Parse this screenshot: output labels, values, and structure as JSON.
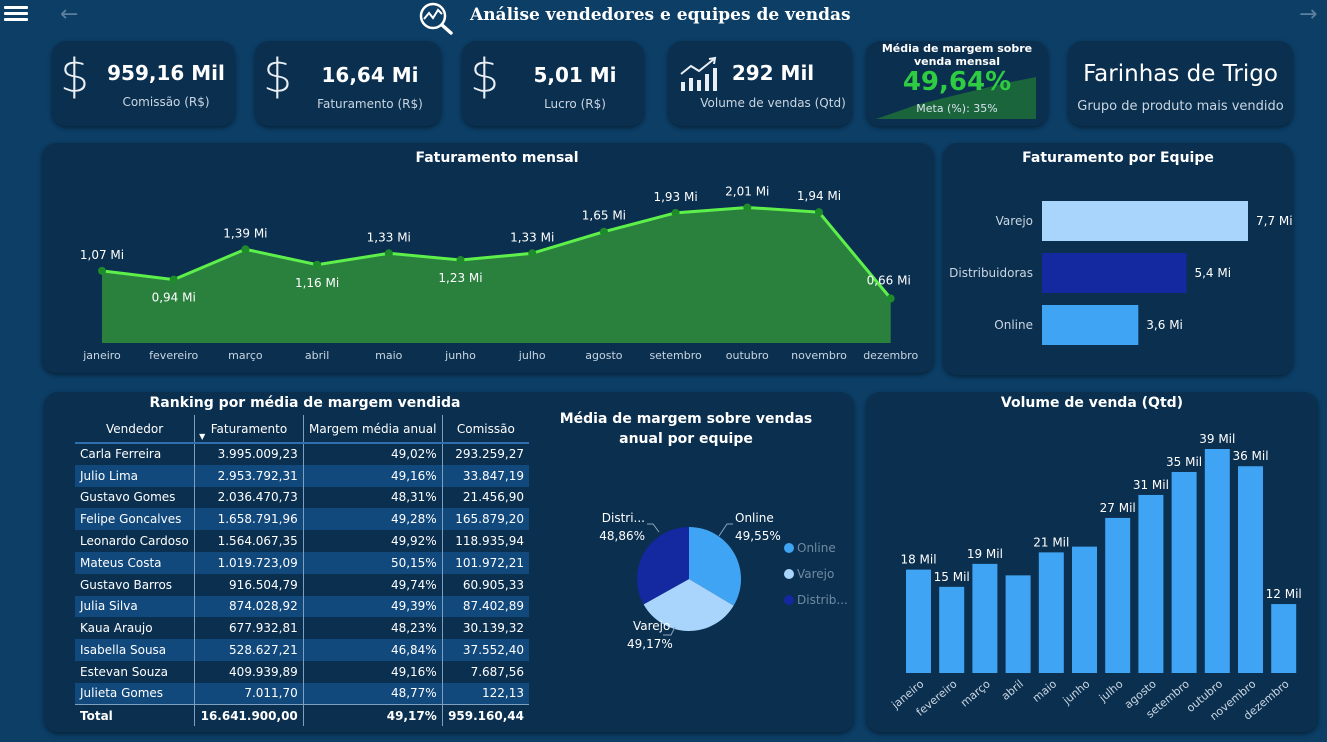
{
  "header": {
    "title": "Análise vendedores e equipes de vendas"
  },
  "kpis": {
    "comissao": {
      "value": "959,16 Mil",
      "label": "Comissão (R$)"
    },
    "faturamento": {
      "value": "16,64 Mi",
      "label": "Faturamento (R$)"
    },
    "lucro": {
      "value": "5,01 Mi",
      "label": "Lucro (R$)"
    },
    "volume": {
      "value": "292 Mil",
      "label": "Volume de vendas (Qtd)"
    },
    "margem": {
      "title": "Média de margem sobre venda mensal",
      "value": "49,64%",
      "meta": "Meta (%): 35%"
    },
    "grupo": {
      "value": "Farinhas de Trigo",
      "label": "Grupo de produto mais vendido"
    }
  },
  "colors": {
    "background": "#0c3e66",
    "card": "#0b2f4f",
    "line": "#5ef04a",
    "area": "#2e8b3c",
    "barLight": "#a9d4fb",
    "barNavy": "#1428a0",
    "barBlue": "#40a4f4",
    "marginGreen": "#2ecc40"
  },
  "chart_data": [
    {
      "id": "monthly",
      "type": "area",
      "title": "Faturamento mensal",
      "categories": [
        "janeiro",
        "fevereiro",
        "março",
        "abril",
        "maio",
        "junho",
        "julho",
        "agosto",
        "setembro",
        "outubro",
        "novembro",
        "dezembro"
      ],
      "values": [
        1.07,
        0.94,
        1.39,
        1.16,
        1.33,
        1.23,
        1.33,
        1.65,
        1.93,
        2.01,
        1.94,
        0.66
      ],
      "labels": [
        "1,07 Mi",
        "0,94 Mi",
        "1,39 Mi",
        "1,16 Mi",
        "1,33 Mi",
        "1,23 Mi",
        "1,33 Mi",
        "1,65 Mi",
        "1,93 Mi",
        "2,01 Mi",
        "1,94 Mi",
        "0,66 Mi"
      ]
    },
    {
      "id": "team",
      "type": "bar",
      "title": "Faturamento por Equipe",
      "categories": [
        "Varejo",
        "Distribuidoras",
        "Online"
      ],
      "values": [
        7.7,
        5.4,
        3.6
      ],
      "labels": [
        "7,7 Mi",
        "5,4 Mi",
        "3,6 Mi"
      ]
    },
    {
      "id": "pie",
      "type": "pie",
      "title": "Média de margem sobre vendas anual por equipe",
      "categories": [
        "Online",
        "Varejo",
        "Distrib..."
      ],
      "slice_labels": [
        "Online",
        "Varejo",
        "Distri..."
      ],
      "values": [
        49.55,
        49.17,
        48.86
      ],
      "labels": [
        "49,55%",
        "49,17%",
        "48,86%"
      ]
    },
    {
      "id": "volume",
      "type": "bar",
      "title": "Volume de venda (Qtd)",
      "categories": [
        "janeiro",
        "fevereiro",
        "março",
        "abril",
        "maio",
        "junho",
        "julho",
        "agosto",
        "setembro",
        "outubro",
        "novembro",
        "dezembro"
      ],
      "values": [
        18,
        15,
        19,
        17,
        21,
        22,
        27,
        31,
        35,
        39,
        36,
        12
      ],
      "labels": [
        "18 Mil",
        "15 Mil",
        "19 Mil",
        "",
        "21 Mil",
        "",
        "27 Mil",
        "31 Mil",
        "35 Mil",
        "39 Mil",
        "36 Mil",
        "12 Mil"
      ]
    }
  ],
  "ranking": {
    "title": "Ranking por média de margem vendida",
    "columns": [
      "Vendedor",
      "Faturamento",
      "Margem média anual",
      "Comissão"
    ],
    "rows": [
      [
        "Carla Ferreira",
        "3.995.009,23",
        "49,02%",
        "293.259,27"
      ],
      [
        "Julio Lima",
        "2.953.792,31",
        "49,16%",
        "33.847,19"
      ],
      [
        "Gustavo Gomes",
        "2.036.470,73",
        "48,31%",
        "21.456,90"
      ],
      [
        "Felipe Goncalves",
        "1.658.791,96",
        "49,28%",
        "165.879,20"
      ],
      [
        "Leonardo Cardoso",
        "1.564.067,35",
        "49,92%",
        "118.935,94"
      ],
      [
        "Mateus Costa",
        "1.019.723,09",
        "50,15%",
        "101.972,21"
      ],
      [
        "Gustavo Barros",
        "916.504,79",
        "49,74%",
        "60.905,33"
      ],
      [
        "Julia Silva",
        "874.028,92",
        "49,39%",
        "87.402,89"
      ],
      [
        "Kaua Araujo",
        "677.932,81",
        "48,23%",
        "30.139,32"
      ],
      [
        "Isabella Sousa",
        "528.627,21",
        "46,84%",
        "37.552,40"
      ],
      [
        "Estevan Souza",
        "409.939,89",
        "49,16%",
        "7.687,56"
      ],
      [
        "Julieta Gomes",
        "7.011,70",
        "48,77%",
        "122,13"
      ]
    ],
    "total": [
      "Total",
      "16.641.900,00",
      "49,17%",
      "959.160,44"
    ]
  }
}
